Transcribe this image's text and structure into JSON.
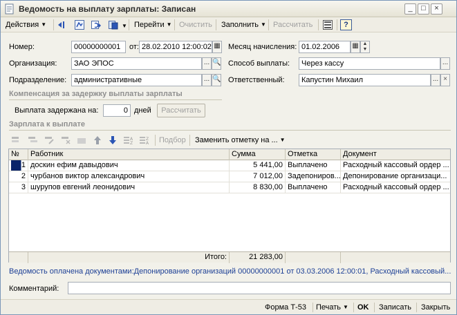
{
  "window": {
    "title": "Ведомость на выплату зарплаты: Записан",
    "minimize": "_",
    "maximize": "□",
    "close": "×"
  },
  "toolbar": {
    "actions": "Действия",
    "goto": "Перейти",
    "clear": "Очистить",
    "fill": "Заполнить",
    "calculate": "Рассчитать",
    "help": "?"
  },
  "form": {
    "number_label": "Номер:",
    "number_value": "00000000001",
    "from_label": "от:",
    "date_value": "28.02.2010 12:00:02",
    "month_label": "Месяц начисления:",
    "month_value": "01.02.2006",
    "org_label": "Организация:",
    "org_value": "ЗАО ЭПОС",
    "payment_label": "Способ выплаты:",
    "payment_value": "Через кассу",
    "dept_label": "Подразделение:",
    "dept_value": "административные",
    "responsible_label": "Ответственный:",
    "responsible_value": "Капустин Михаил"
  },
  "compensation": {
    "title": "Компенсация за задержку выплаты зарплаты",
    "delay_label": "Выплата задержана на:",
    "delay_value": "0",
    "days_label": "дней",
    "calc_button": "Рассчитать"
  },
  "salary": {
    "title": "Зарплата к выплате",
    "select_button": "Подбор",
    "replace_mark": "Заменить отметку на ..."
  },
  "table": {
    "columns": [
      "№",
      "Работник",
      "Сумма",
      "Отметка",
      "Документ"
    ],
    "rows": [
      {
        "n": "1",
        "worker": "доскин ефим давыдович",
        "sum": "5 441,00",
        "mark": "Выплачено",
        "doc": "Расходный кассовый ордер ..."
      },
      {
        "n": "2",
        "worker": "чурбанов виктор александрович",
        "sum": "7 012,00",
        "mark": "Задепониров...",
        "doc": "Депонирование организаци..."
      },
      {
        "n": "3",
        "worker": "шурупов евгений леонидович",
        "sum": "8 830,00",
        "mark": "Выплачено",
        "doc": "Расходный кассовый ордер ..."
      }
    ],
    "total_label": "Итого:",
    "total_value": "21 283,00"
  },
  "status_text": "Ведомость оплачена документами:Депонирование организаций 00000000001 от 03.03.2006 12:00:01, Расходный кассовый...",
  "comment": {
    "label": "Комментарий:",
    "value": ""
  },
  "bottom": {
    "form_t53": "Форма Т-53",
    "print": "Печать",
    "ok": "OK",
    "save": "Записать",
    "close": "Закрыть"
  }
}
